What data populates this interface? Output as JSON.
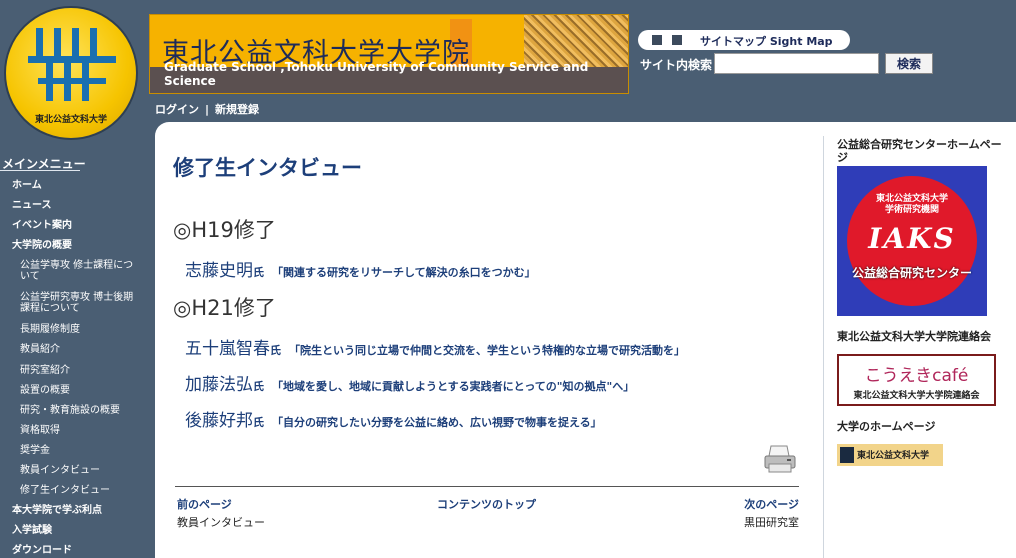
{
  "header": {
    "logo_text": "東北公益文科大学",
    "banner_title": "東北公益文科大学大学院",
    "banner_subtitle": "Graduate School ,Tohoku University of Community Service and Science",
    "sitemap_label": "サイトマップ  Sight Map",
    "search_label": "サイト内検索",
    "search_value": "",
    "search_button": "検索",
    "login_link": "ログイン",
    "separator": "|",
    "register_link": "新規登録"
  },
  "sidebar": {
    "heading": "メインメニュー",
    "items": [
      {
        "label": "ホーム",
        "sub": false
      },
      {
        "label": "ニュース",
        "sub": false
      },
      {
        "label": "イベント案内",
        "sub": false
      },
      {
        "label": "大学院の概要",
        "sub": false
      },
      {
        "label": "公益学専攻 修士課程について",
        "sub": true
      },
      {
        "label": "公益学研究専攻 博士後期課程について",
        "sub": true
      },
      {
        "label": "長期履修制度",
        "sub": true
      },
      {
        "label": "教員紹介",
        "sub": true
      },
      {
        "label": "研究室紹介",
        "sub": true
      },
      {
        "label": "設置の概要",
        "sub": true
      },
      {
        "label": "研究・教育施設の概要",
        "sub": true
      },
      {
        "label": "資格取得",
        "sub": true
      },
      {
        "label": "奨学金",
        "sub": true
      },
      {
        "label": "教員インタビュー",
        "sub": true
      },
      {
        "label": "修了生インタビュー",
        "sub": true
      },
      {
        "label": "本大学院で学ぶ利点",
        "sub": false
      },
      {
        "label": "入学試験",
        "sub": false
      },
      {
        "label": "ダウンロード",
        "sub": false
      }
    ]
  },
  "main": {
    "title": "修了生インタビュー",
    "sections": [
      {
        "year": "◎H19修了",
        "interviews": [
          {
            "name": "志藤史明",
            "honorific": "氏",
            "title": "「関連する研究をリサーチして解決の糸口をつかむ」"
          }
        ]
      },
      {
        "year": "◎H21修了",
        "interviews": [
          {
            "name": "五十嵐智春",
            "honorific": "氏",
            "title": "「院生という同じ立場で仲間と交流を、学生という特権的な立場で研究活動を」"
          },
          {
            "name": "加藤法弘",
            "honorific": "氏",
            "title": "「地域を愛し、地域に貢献しようとする実践者にとっての\"知の拠点\"へ」"
          },
          {
            "name": "後藤好邦",
            "honorific": "氏",
            "title": "「自分の研究したい分野を公益に絡め、広い視野で物事を捉える」"
          }
        ]
      }
    ],
    "nav": {
      "prev_label": "前のページ",
      "prev_value": "教員インタビュー",
      "top_label": "コンテンツのトップ",
      "next_label": "次のページ",
      "next_value": "黒田研究室"
    }
  },
  "right": {
    "center_heading": "公益総合研究センターホームページ",
    "iaks_top": "東北公益文科大学\n学術研究機関",
    "iaks_word": "IAKS",
    "iaks_bottom": "公益総合研究センター",
    "cafe_heading": "東北公益文科大学大学院連絡会",
    "cafe_word": "こうえきcafé",
    "cafe_org": "東北公益文科大学大学院連絡会",
    "univ_heading": "大学のホームページ",
    "univ_badge": "東北公益文科大学"
  },
  "colors": {
    "background": "#4a5e73",
    "banner": "#f6b200",
    "link": "#1d3f7a",
    "iaks_blue": "#2f3db8",
    "iaks_red": "#e0192a"
  }
}
